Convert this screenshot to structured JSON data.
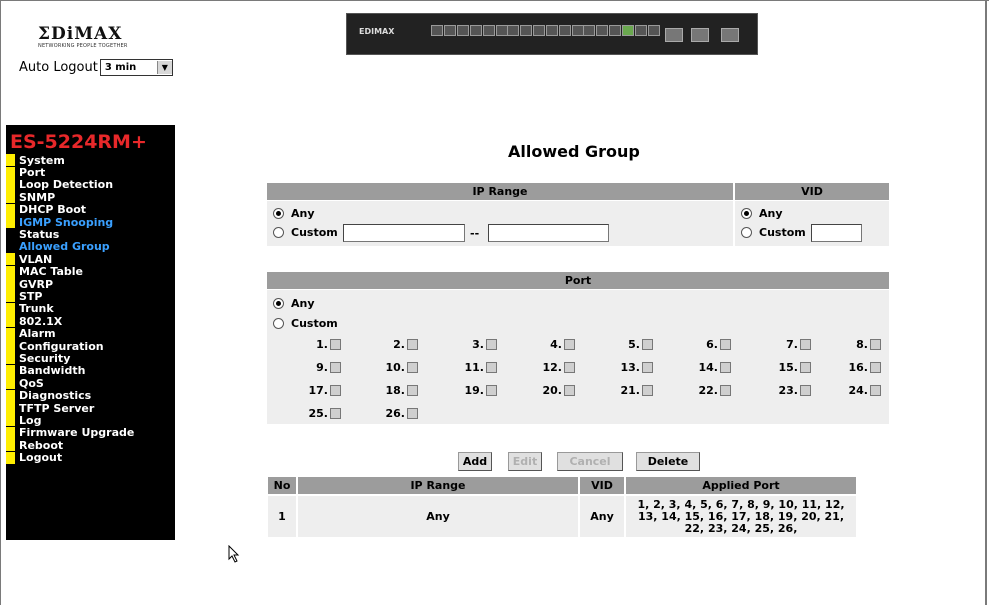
{
  "logo": {
    "word": "ΣDiMAX",
    "tagline": "NETWORKING PEOPLE TOGETHER"
  },
  "auto_logout": {
    "label": "Auto Logout",
    "value": "3 min"
  },
  "device": {
    "brand": "EDIMAX"
  },
  "sidebar": {
    "model": "ES-5224RM+",
    "items": [
      {
        "label": "System"
      },
      {
        "label": "Port"
      },
      {
        "label": "Loop Detection"
      },
      {
        "label": "SNMP"
      },
      {
        "label": "DHCP Boot"
      },
      {
        "label": "IGMP Snooping"
      },
      {
        "label": "Status"
      },
      {
        "label": "Allowed Group"
      },
      {
        "label": "VLAN"
      },
      {
        "label": "MAC Table"
      },
      {
        "label": "GVRP"
      },
      {
        "label": "STP"
      },
      {
        "label": "Trunk"
      },
      {
        "label": "802.1X"
      },
      {
        "label": "Alarm"
      },
      {
        "label": "Configuration"
      },
      {
        "label": "Security"
      },
      {
        "label": "Bandwidth"
      },
      {
        "label": "QoS"
      },
      {
        "label": "Diagnostics"
      },
      {
        "label": "TFTP Server"
      },
      {
        "label": "Log"
      },
      {
        "label": "Firmware Upgrade"
      },
      {
        "label": "Reboot"
      },
      {
        "label": "Logout"
      }
    ]
  },
  "page_title": "Allowed Group",
  "ip_range": {
    "header": "IP Range",
    "any_label": "Any",
    "custom_label": "Custom",
    "separator": "--",
    "selected": "Any"
  },
  "vid": {
    "header": "VID",
    "any_label": "Any",
    "custom_label": "Custom",
    "selected": "Any"
  },
  "port": {
    "header": "Port",
    "any_label": "Any",
    "custom_label": "Custom",
    "selected": "Any",
    "ports": [
      "1.",
      "2.",
      "3.",
      "4.",
      "5.",
      "6.",
      "7.",
      "8.",
      "9.",
      "10.",
      "11.",
      "12.",
      "13.",
      "14.",
      "15.",
      "16.",
      "17.",
      "18.",
      "19.",
      "20.",
      "21.",
      "22.",
      "23.",
      "24.",
      "25.",
      "26."
    ]
  },
  "buttons": {
    "add": "Add",
    "edit": "Edit",
    "cancel": "Cancel",
    "delete": "Delete"
  },
  "table": {
    "headers": {
      "no": "No",
      "ip_range": "IP Range",
      "vid": "VID",
      "applied_port": "Applied Port"
    },
    "rows": [
      {
        "no": "1",
        "ip_range": "Any",
        "vid": "Any",
        "applied_port": "1, 2, 3, 4, 5, 6, 7, 8, 9, 10, 11, 12, 13, 14, 15, 16, 17, 18, 19, 20, 21, 22, 23, 24, 25, 26,"
      }
    ]
  }
}
